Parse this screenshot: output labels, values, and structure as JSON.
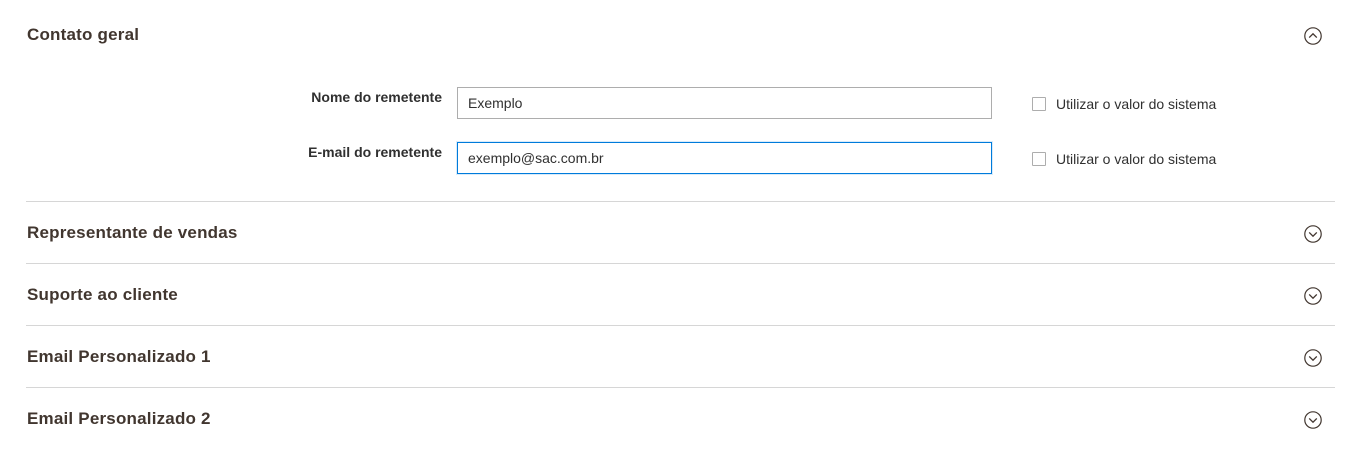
{
  "sections": {
    "general_contact": {
      "title": "Contato geral",
      "expanded": true,
      "fields": {
        "sender_name": {
          "label": "Nome do remetente",
          "value": "Exemplo",
          "use_system_value_label": "Utilizar o valor do sistema",
          "use_system_value_checked": false
        },
        "sender_email": {
          "label": "E-mail do remetente",
          "value": "exemplo@sac.com.br",
          "use_system_value_label": "Utilizar o valor do sistema",
          "use_system_value_checked": false
        }
      }
    },
    "sales_representative": {
      "title": "Representante de vendas",
      "expanded": false
    },
    "customer_support": {
      "title": "Suporte ao cliente",
      "expanded": false
    },
    "custom_email_1": {
      "title": "Email Personalizado 1",
      "expanded": false
    },
    "custom_email_2": {
      "title": "Email Personalizado 2",
      "expanded": false
    }
  },
  "icons": {
    "expanded": "chevron-up-circle-icon",
    "collapsed": "chevron-down-circle-icon"
  },
  "colors": {
    "section_title": "#41362f",
    "divider": "#d6d6d6",
    "input_border": "#adadad",
    "input_focus_border": "#007bdb"
  }
}
